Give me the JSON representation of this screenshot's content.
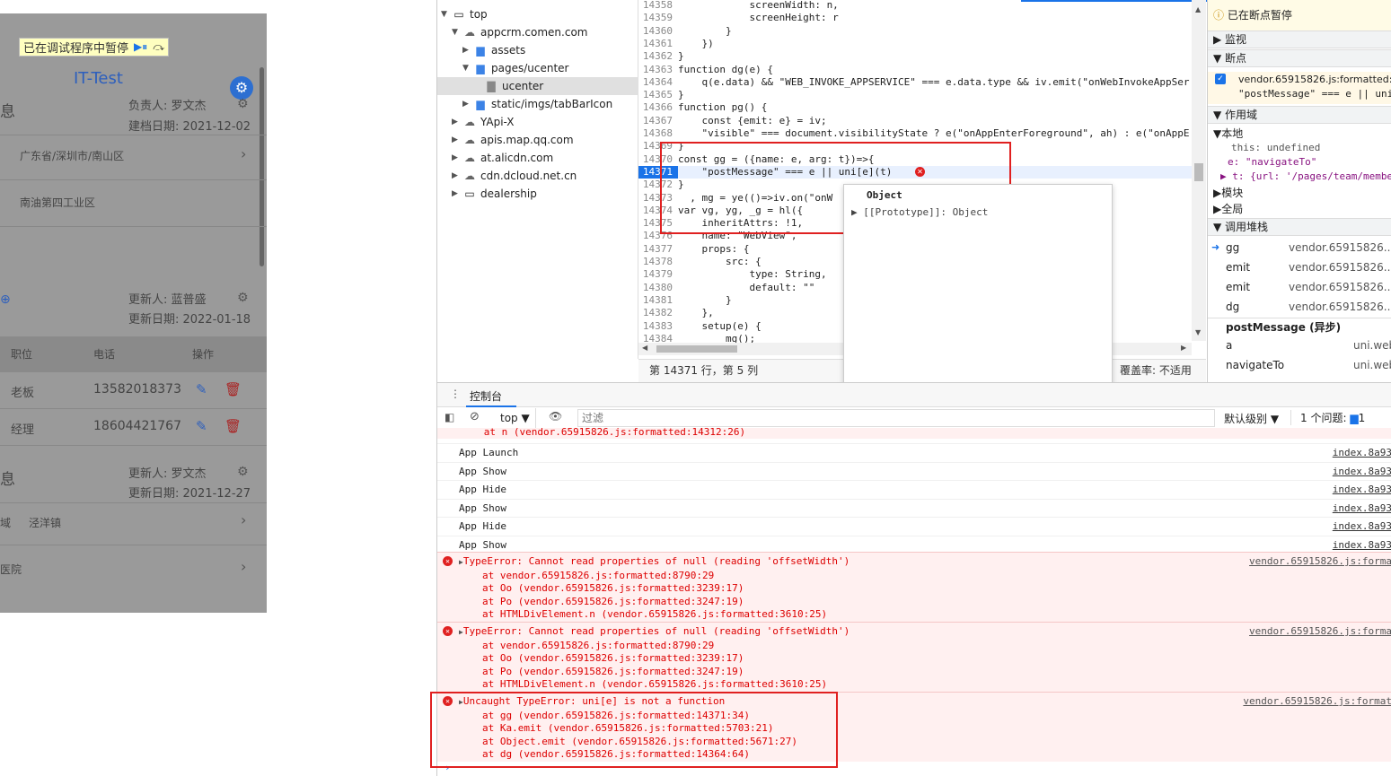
{
  "app": {
    "paused_label": "已在调试程序中暂停",
    "title": "IT-Test",
    "section1": "息",
    "owner": "负责人: 罗文杰",
    "created": "建档日期: 2021-12-02",
    "address1": "广东省/深圳市/南山区",
    "address2": "南油第四工业区",
    "updater": "更新人: 蓝普盛",
    "updated": "更新日期: 2022-01-18",
    "columns": [
      "职位",
      "电话",
      "操作"
    ],
    "rows": [
      {
        "role": "老板",
        "phone": "13582018373"
      },
      {
        "role": "经理",
        "phone": "18604421767"
      }
    ],
    "section2": "息",
    "updater2": "更新人: 罗文杰",
    "updated2": "更新日期: 2021-12-27",
    "area_prefix": "域",
    "area": "泾洋镇",
    "hospital": "医院"
  },
  "tree": [
    {
      "label": "top",
      "type": "frame",
      "depth": 0,
      "open": true
    },
    {
      "label": "appcrm.comen.com",
      "type": "cloud",
      "depth": 1,
      "open": true
    },
    {
      "label": "assets",
      "type": "folder",
      "depth": 2,
      "open": false
    },
    {
      "label": "pages/ucenter",
      "type": "folder",
      "depth": 2,
      "open": true
    },
    {
      "label": "ucenter",
      "type": "file",
      "depth": 3,
      "selected": true
    },
    {
      "label": "static/imgs/tabBarIcon",
      "type": "folder",
      "depth": 2,
      "open": false
    },
    {
      "label": "YApi-X",
      "type": "cloud",
      "depth": 1,
      "open": false
    },
    {
      "label": "apis.map.qq.com",
      "type": "cloud",
      "depth": 1,
      "open": false
    },
    {
      "label": "at.alicdn.com",
      "type": "cloud",
      "depth": 1,
      "open": false
    },
    {
      "label": "cdn.dcloud.net.cn",
      "type": "cloud",
      "depth": 1,
      "open": false
    },
    {
      "label": "dealership",
      "type": "frame",
      "depth": 1,
      "open": false
    }
  ],
  "code": [
    {
      "n": "14358",
      "t": "            screenWidth: n,"
    },
    {
      "n": "14359",
      "t": "            screenHeight: r"
    },
    {
      "n": "14360",
      "t": "        }"
    },
    {
      "n": "14361",
      "t": "    })"
    },
    {
      "n": "14362",
      "t": "}"
    },
    {
      "n": "14363",
      "t": "function dg(e) {"
    },
    {
      "n": "14364",
      "t": "    q(e.data) && \"WEB_INVOKE_APPSERVICE\" === e.data.type && iv.emit(\"onWebInvokeAppSer"
    },
    {
      "n": "14365",
      "t": "}"
    },
    {
      "n": "14366",
      "t": "function pg() {"
    },
    {
      "n": "14367",
      "t": "    const {emit: e} = iv;"
    },
    {
      "n": "14368",
      "t": "    \"visible\" === document.visibilityState ? e(\"onAppEnterForeground\", ah) : e(\"onAppE"
    },
    {
      "n": "14369",
      "t": "}"
    },
    {
      "n": "14370",
      "t": "const gg = ({name: e, arg: t})=>{"
    },
    {
      "n": "14371",
      "t": "    \"postMessage\" === e || uni[e](t)"
    },
    {
      "n": "14372",
      "t": "}"
    },
    {
      "n": "14373",
      "t": "  , mg = ye(()=>iv.on(\"onW"
    },
    {
      "n": "14374",
      "t": "var vg, yg, _g = hl({"
    },
    {
      "n": "14375",
      "t": "    inheritAttrs: !1,"
    },
    {
      "n": "14376",
      "t": "    name: \"WebView\","
    },
    {
      "n": "14377",
      "t": "    props: {"
    },
    {
      "n": "14378",
      "t": "        src: {"
    },
    {
      "n": "14379",
      "t": "            type: String,"
    },
    {
      "n": "14380",
      "t": "            default: \"\""
    },
    {
      "n": "14381",
      "t": "        }"
    },
    {
      "n": "14382",
      "t": "    },"
    },
    {
      "n": "14383",
      "t": "    setup(e) {"
    },
    {
      "n": "14384",
      "t": "        mg();"
    }
  ],
  "popup": {
    "title": "Object",
    "proto": "[[Prototype]]: Object"
  },
  "status": {
    "position": "第 14371 行，第 5 列",
    "coverage": "覆盖率: 不适用"
  },
  "right": {
    "paused": "已在断点暂停",
    "watch": "监视",
    "breakpoints": "断点",
    "bp_file": "vendor.65915826.js:formatted:14",
    "bp_code": "\"postMessage\" === e || uni",
    "scope": "作用域",
    "local": "本地",
    "this": "this: undefined",
    "e": "e: \"navigateTo\"",
    "t": "t: {url: '/pages/team/member",
    "module": "模块",
    "global": "全局",
    "callstack": "调用堆栈",
    "frames": [
      {
        "name": "gg",
        "src": "vendor.65915826...orr"
      },
      {
        "name": "emit",
        "src": "vendor.65915826...fo"
      },
      {
        "name": "emit",
        "src": "vendor.65915826...fo"
      },
      {
        "name": "dg",
        "src": "vendor.65915826...orr"
      }
    ],
    "async": "postMessage (异步)",
    "frames2": [
      {
        "name": "a",
        "src": "uni.webv"
      },
      {
        "name": "navigateTo",
        "src": "uni.webv"
      }
    ]
  },
  "console": {
    "tab": "控制台",
    "context": "top",
    "filter_placeholder": "过滤",
    "levels": "默认级别",
    "issues": "1 个问题:",
    "issue_count": "1",
    "lines": [
      {
        "text": "      at n (vendor.65915826.js:formatted:14312:26)",
        "kind": "errtail",
        "src": ""
      },
      {
        "text": "App Launch",
        "kind": "log",
        "src": "index.8a93"
      },
      {
        "text": "App Show",
        "kind": "log",
        "src": "index.8a93"
      },
      {
        "text": "App Hide",
        "kind": "log",
        "src": "index.8a93"
      },
      {
        "text": "App Show",
        "kind": "log",
        "src": "index.8a93"
      },
      {
        "text": "App Hide",
        "kind": "log",
        "src": "index.8a93"
      },
      {
        "text": "App Show",
        "kind": "log",
        "src": "index.8a93"
      }
    ],
    "errors": [
      {
        "head": "TypeError: Cannot read properties of null (reading 'offsetWidth')",
        "src": "vendor.65915826.js:forma",
        "stack": [
          "at vendor.65915826.js:formatted:8790:29",
          "at Oo (vendor.65915826.js:formatted:3239:17)",
          "at Po (vendor.65915826.js:formatted:3247:19)",
          "at HTMLDivElement.n (vendor.65915826.js:formatted:3610:25)"
        ]
      },
      {
        "head": "TypeError: Cannot read properties of null (reading 'offsetWidth')",
        "src": "vendor.65915826.js:forma",
        "stack": [
          "at vendor.65915826.js:formatted:8790:29",
          "at Oo (vendor.65915826.js:formatted:3239:17)",
          "at Po (vendor.65915826.js:formatted:3247:19)",
          "at HTMLDivElement.n (vendor.65915826.js:formatted:3610:25)"
        ]
      },
      {
        "head": "Uncaught TypeError: uni[e] is not a function",
        "src": "vendor.65915826.js:format",
        "stack": [
          "at gg (vendor.65915826.js:formatted:14371:34)",
          "at Ka.emit (vendor.65915826.js:formatted:5703:21)",
          "at Object.emit (vendor.65915826.js:formatted:5671:27)",
          "at dg (vendor.65915826.js:formatted:14364:64)"
        ]
      }
    ]
  },
  "colors": {
    "accent": "#1a73e8",
    "error": "#d00000",
    "highlight": "#e02020"
  }
}
